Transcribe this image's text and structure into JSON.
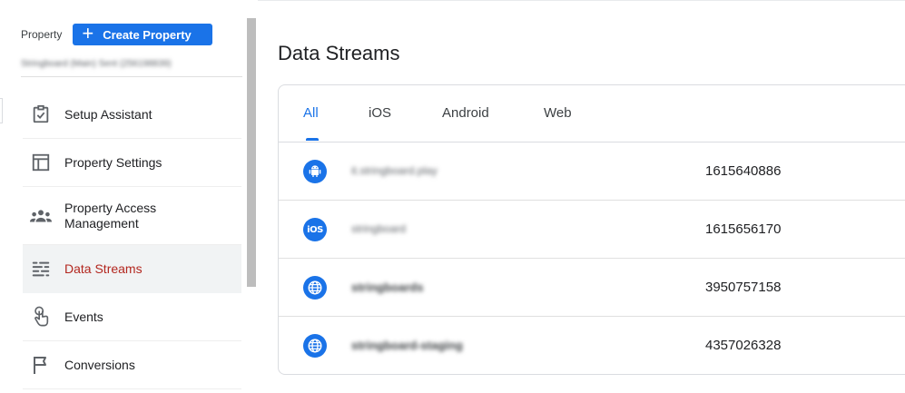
{
  "left_panel": {
    "property_label": "Property",
    "create_button": "Create Property",
    "property_name": "Stringboard (Main) Sent (256198839)",
    "nav": [
      {
        "label": "Setup Assistant",
        "icon": "checklist-icon"
      },
      {
        "label": "Property Settings",
        "icon": "layout-icon"
      },
      {
        "label": "Property Access Management",
        "icon": "people-icon"
      },
      {
        "label": "Data Streams",
        "icon": "streams-icon",
        "active": true
      },
      {
        "label": "Events",
        "icon": "touch-icon"
      },
      {
        "label": "Conversions",
        "icon": "flag-icon"
      }
    ]
  },
  "main": {
    "title": "Data Streams",
    "tabs": [
      "All",
      "iOS",
      "Android",
      "Web"
    ],
    "active_tab": "All",
    "streams": [
      {
        "type": "android",
        "name": "it.stringboard.play",
        "id": "1615640886"
      },
      {
        "type": "ios",
        "name": "stringboard",
        "id": "1615656170"
      },
      {
        "type": "web",
        "name": "stringboards",
        "id": "3950757158"
      },
      {
        "type": "web",
        "name": "stringboard-staging",
        "id": "4357026328"
      }
    ]
  },
  "colors": {
    "accent": "#1a73e8",
    "active_nav_text": "#b3261e",
    "top_accent": "#e37400"
  }
}
